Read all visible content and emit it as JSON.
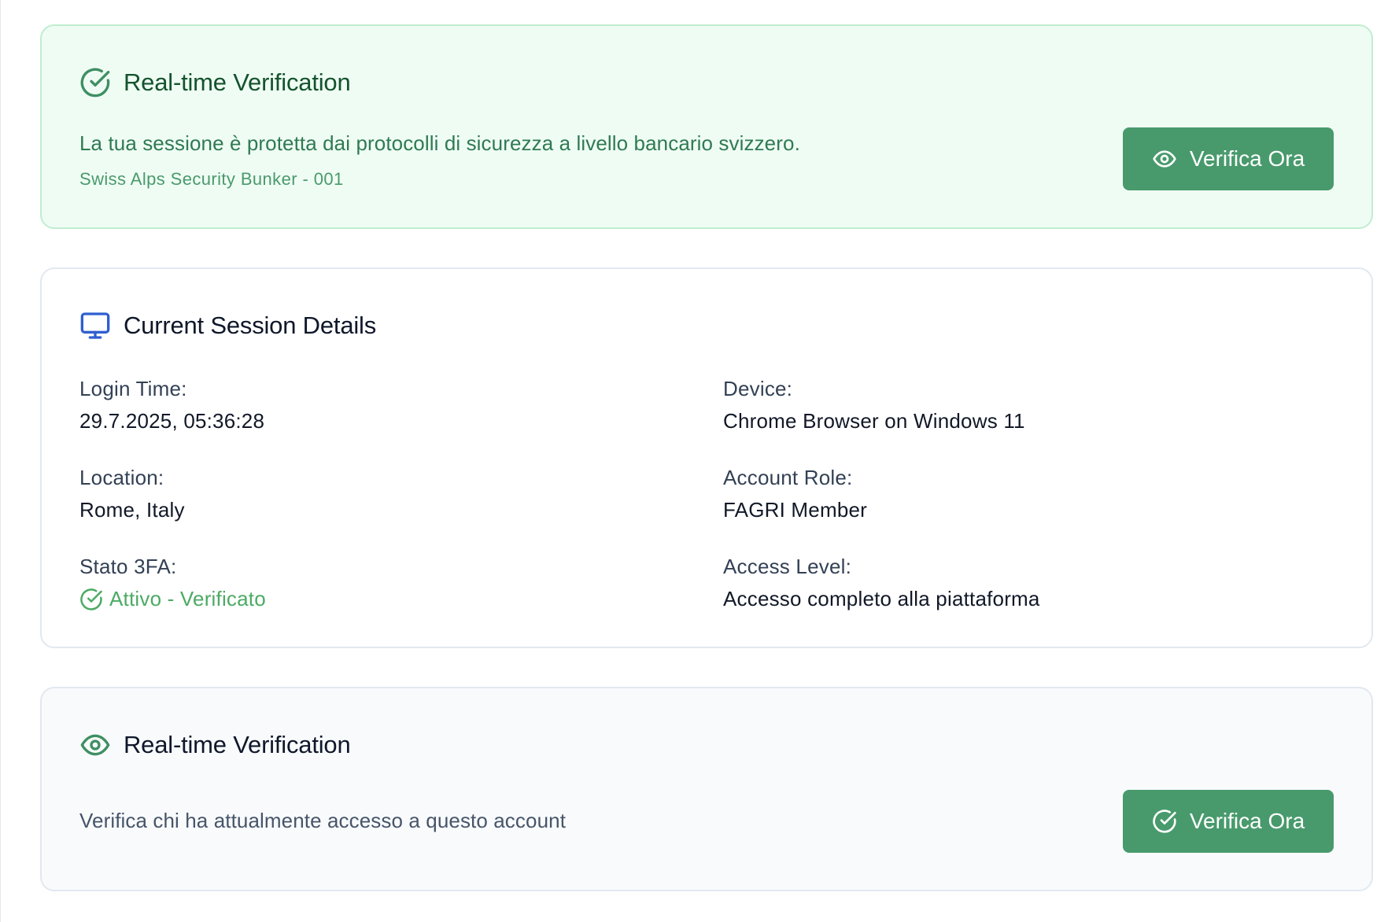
{
  "verification_banner": {
    "title": "Real-time Verification",
    "description": "La tua sessione è protetta dai protocolli di sicurezza a livello bancario svizzero.",
    "subtitle": "Swiss Alps Security Bunker - 001",
    "button_label": "Verifica Ora",
    "title_icon": "check-circle-icon",
    "button_icon": "eye-icon"
  },
  "session": {
    "title": "Current Session Details",
    "title_icon": "monitor-icon",
    "login_time": {
      "label": "Login Time:",
      "value": "29.7.2025, 05:36:28"
    },
    "device": {
      "label": "Device:",
      "value": "Chrome Browser on Windows 11"
    },
    "location": {
      "label": "Location:",
      "value": "Rome, Italy"
    },
    "account_role": {
      "label": "Account Role:",
      "value": "FAGRI Member"
    },
    "stato_3fa": {
      "label": "Stato 3FA:",
      "value": "Attivo - Verificato",
      "icon": "check-circle-icon"
    },
    "access_level": {
      "label": "Access Level:",
      "value": "Accesso completo alla piattaforma"
    }
  },
  "verification_access": {
    "title": "Real-time Verification",
    "title_icon": "eye-icon",
    "description": "Verifica chi ha attualmente accesso a questo account",
    "button_label": "Verifica Ora",
    "button_icon": "check-circle-icon"
  },
  "colors": {
    "accent_green": "#489a6c",
    "status_green": "#4caa64",
    "banner_background": "#effcf4",
    "monitor_icon_blue": "#2563eb"
  }
}
